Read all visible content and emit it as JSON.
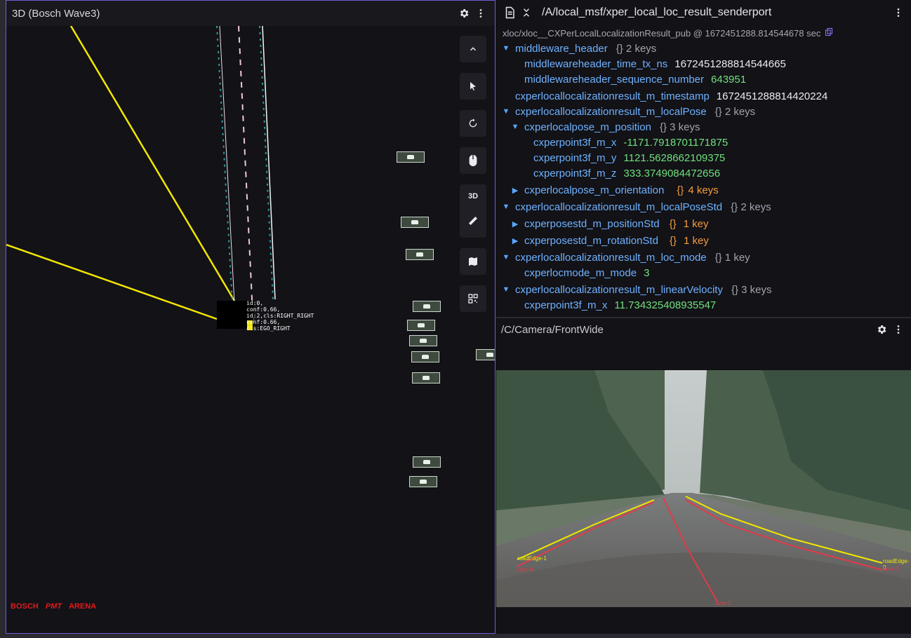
{
  "left_panel": {
    "title": "3D (Bosch Wave3)",
    "icons": [
      "gear-icon",
      "more-vert-icon"
    ],
    "toolbar": {
      "buttons": [
        "chevron-up-icon",
        "select-cursor-icon",
        "rotate-icon",
        "mouse-icon",
        "3d-toggle",
        "ruler-icon",
        "map-icon",
        "qr-icon"
      ],
      "mode_label": "3D"
    },
    "ego_labels": {
      "label_a": "id:0,\nconf:0.66,\nid:2,cls:RIGHT_RIGHT\nconf:0.66,\ncls:EGO_RIGHT"
    },
    "logos": {
      "bosch": "BOSCH",
      "pmt": "PMT",
      "arena": "ARENA"
    }
  },
  "message_panel": {
    "topic": "/A/local_msf/xper_local_loc_result_senderport",
    "subtitle": "xloc/xloc__CXPerLocalLocalizationResult_pub @ 1672451288.814544678 sec",
    "rows": [
      {
        "key": "middleware_header",
        "meta": "{}  2 keys",
        "expand": "open"
      },
      {
        "key": "middlewareheader_time_tx_ns",
        "value": "1672451288814544665"
      },
      {
        "key": "middlewareheader_sequence_number",
        "value": "643951"
      },
      {
        "key": "cxperlocallocalizationresult_m_timestamp",
        "value": "1672451288814420224"
      },
      {
        "key": "cxperlocallocalizationresult_m_localPose",
        "meta": "{}  2 keys",
        "expand": "open"
      },
      {
        "key": "cxperlocalpose_m_position",
        "meta": "{}  3 keys",
        "expand": "open"
      },
      {
        "key": "cxperpoint3f_m_x",
        "value": "-1171.7918701171875"
      },
      {
        "key": "cxperpoint3f_m_y",
        "value": "1121.5628662109375"
      },
      {
        "key": "cxperpoint3f_m_z",
        "value": "333.3749084472656"
      },
      {
        "key": "cxperlocalpose_m_orientation",
        "braces": "{}",
        "meta": "4 keys",
        "expand": "closed"
      },
      {
        "key": "cxperlocallocalizationresult_m_localPoseStd",
        "meta": "{}  2 keys",
        "expand": "open"
      },
      {
        "key": "cxperposestd_m_positionStd",
        "braces": "{}",
        "meta": "1 key",
        "expand": "closed"
      },
      {
        "key": "cxperposestd_m_rotationStd",
        "braces": "{}",
        "meta": "1 key",
        "expand": "closed"
      },
      {
        "key": "cxperlocallocalizationresult_m_loc_mode",
        "meta": "{}  1 key",
        "expand": "open"
      },
      {
        "key": "cxperlocmode_m_mode",
        "value": "3"
      },
      {
        "key": "cxperlocallocalizationresult_m_linearVelocity",
        "meta": "{}  3 keys",
        "expand": "open"
      },
      {
        "key": "cxperpoint3f_m_x",
        "value": "11.734325408935547"
      }
    ]
  },
  "camera_panel": {
    "title": "/C/Camera/FrontWide",
    "overlay_labels": {
      "road_edge_left": "roadEdge-1",
      "road_edge_right": "roadEdge-0",
      "lane_left": "lane-0",
      "lane_right": "lane-2",
      "lane_center": "lane-1"
    }
  },
  "colors": {
    "accent_border": "#6f5fd4",
    "key_blue": "#6fb2ff",
    "value_green": "#71e07c",
    "meta_orange": "#f59a3c",
    "yellow_line": "#f2e600",
    "lane_red": "#e23a4a"
  }
}
